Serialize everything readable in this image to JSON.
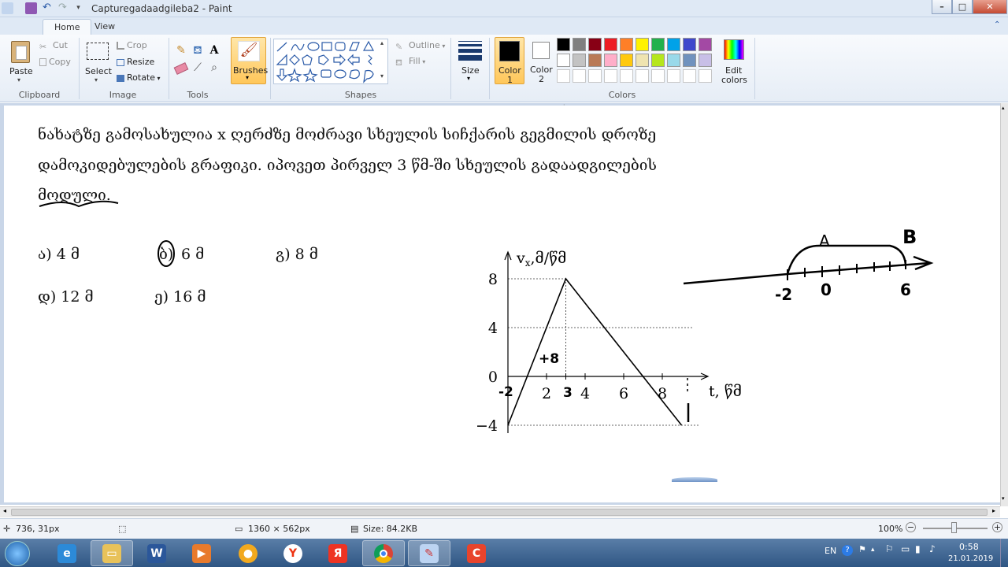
{
  "window": {
    "title": "Capturegadaadgileba2 - Paint",
    "tabs": [
      "Home",
      "View"
    ],
    "min": "–",
    "max": "□",
    "close": "✕"
  },
  "ribbon": {
    "clipboard": {
      "paste": "Paste",
      "cut": "Cut",
      "copy": "Copy",
      "label": "Clipboard"
    },
    "image": {
      "select": "Select",
      "crop": "Crop",
      "resize": "Resize",
      "rotate": "Rotate",
      "label": "Image"
    },
    "tools": {
      "label": "Tools"
    },
    "brushes": "Brushes",
    "shapes": {
      "label": "Shapes",
      "outline": "Outline",
      "fill": "Fill"
    },
    "size": "Size",
    "color1": {
      "line1": "Color",
      "line2": "1"
    },
    "color2": {
      "line1": "Color",
      "line2": "2"
    },
    "colors_label": "Colors",
    "edit_colors": {
      "line1": "Edit",
      "line2": "colors"
    },
    "palette_row1": [
      "#000000",
      "#7f7f7f",
      "#880015",
      "#ed1c24",
      "#ff7f27",
      "#fff200",
      "#22b14c",
      "#00a2e8",
      "#3f48cc",
      "#a349a4"
    ],
    "palette_row2": [
      "#ffffff",
      "#c3c3c3",
      "#b97a57",
      "#ffaec9",
      "#ffc90e",
      "#efe4b0",
      "#b5e61d",
      "#99d9ea",
      "#7092be",
      "#c8bfe7"
    ]
  },
  "document": {
    "question_lines": [
      "ნახატზე გამოსახულია x ღერძზე მოძრავი სხეულის სიჩქარის გეგმილის  დროზე",
      "დამოკიდებულების გრაფიკი. იპოვეთ პირველ 3 წმ-ში სხეულის გადაადგილების",
      "მოდული."
    ],
    "options": {
      "a": "ა) 4 მ",
      "b_letter": "ბ)",
      "b_value": "6 მ",
      "g": "გ) 8 მ",
      "d": "დ) 12 მ",
      "e": "ე) 16 მ"
    },
    "annotations": {
      "graph_plus": "+8",
      "graph_neg2": "-2",
      "graph_3": "3",
      "axis_A": "A",
      "axis_B": "B",
      "axis_minus2": "-2",
      "axis_0": "0",
      "axis_6": "6"
    }
  },
  "chart_data": {
    "type": "line",
    "ylabel_main": "v",
    "ylabel_sub": "x",
    "ylabel_unit": ",მ/წმ",
    "xlabel": "t, წმ",
    "x_ticks": [
      "2",
      "4",
      "6",
      "8"
    ],
    "y_ticks": [
      "8",
      "4",
      "0",
      "−4"
    ],
    "x": [
      0,
      3,
      9
    ],
    "y": [
      -4,
      8,
      -4
    ],
    "xlim": [
      0,
      10
    ],
    "ylim": [
      -4,
      8
    ],
    "guide_lines": [
      {
        "y": 8
      },
      {
        "y": 4
      },
      {
        "y": -4
      },
      {
        "x": 3
      }
    ]
  },
  "status": {
    "cursor": "736, 31px",
    "dimensions": "1360 × 562px",
    "size": "Size: 84.2KB",
    "zoom": "100%"
  },
  "taskbar": {
    "lang": "EN",
    "time": "0:58",
    "date": "21.01.2019"
  }
}
